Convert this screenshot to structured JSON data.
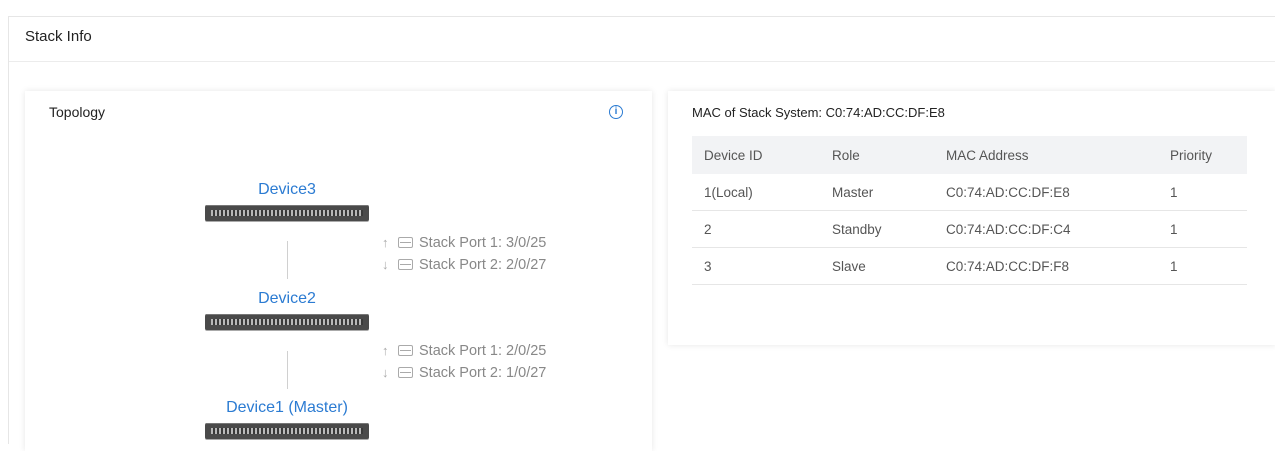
{
  "panel": {
    "title": "Stack Info"
  },
  "topology": {
    "title": "Topology",
    "info_icon": "info-icon",
    "devices": [
      {
        "name": "Device3"
      },
      {
        "name": "Device2"
      },
      {
        "name": "Device1 (Master)"
      }
    ],
    "links": [
      {
        "port1": "Stack Port 1: 3/0/25",
        "port2": "Stack Port 2: 2/0/27"
      },
      {
        "port1": "Stack Port 1: 2/0/25",
        "port2": "Stack Port 2: 1/0/27"
      }
    ]
  },
  "stack_system": {
    "mac_label": "MAC of Stack System: C0:74:AD:CC:DF:E8",
    "columns": [
      "Device ID",
      "Role",
      "MAC Address",
      "Priority"
    ],
    "rows": [
      {
        "device_id": "1(Local)",
        "role": "Master",
        "mac": "C0:74:AD:CC:DF:E8",
        "priority": "1"
      },
      {
        "device_id": "2",
        "role": "Standby",
        "mac": "C0:74:AD:CC:DF:C4",
        "priority": "1"
      },
      {
        "device_id": "3",
        "role": "Slave",
        "mac": "C0:74:AD:CC:DF:F8",
        "priority": "1"
      }
    ]
  },
  "colors": {
    "accent": "#2b7bd2",
    "header_bg": "#f2f3f5"
  }
}
